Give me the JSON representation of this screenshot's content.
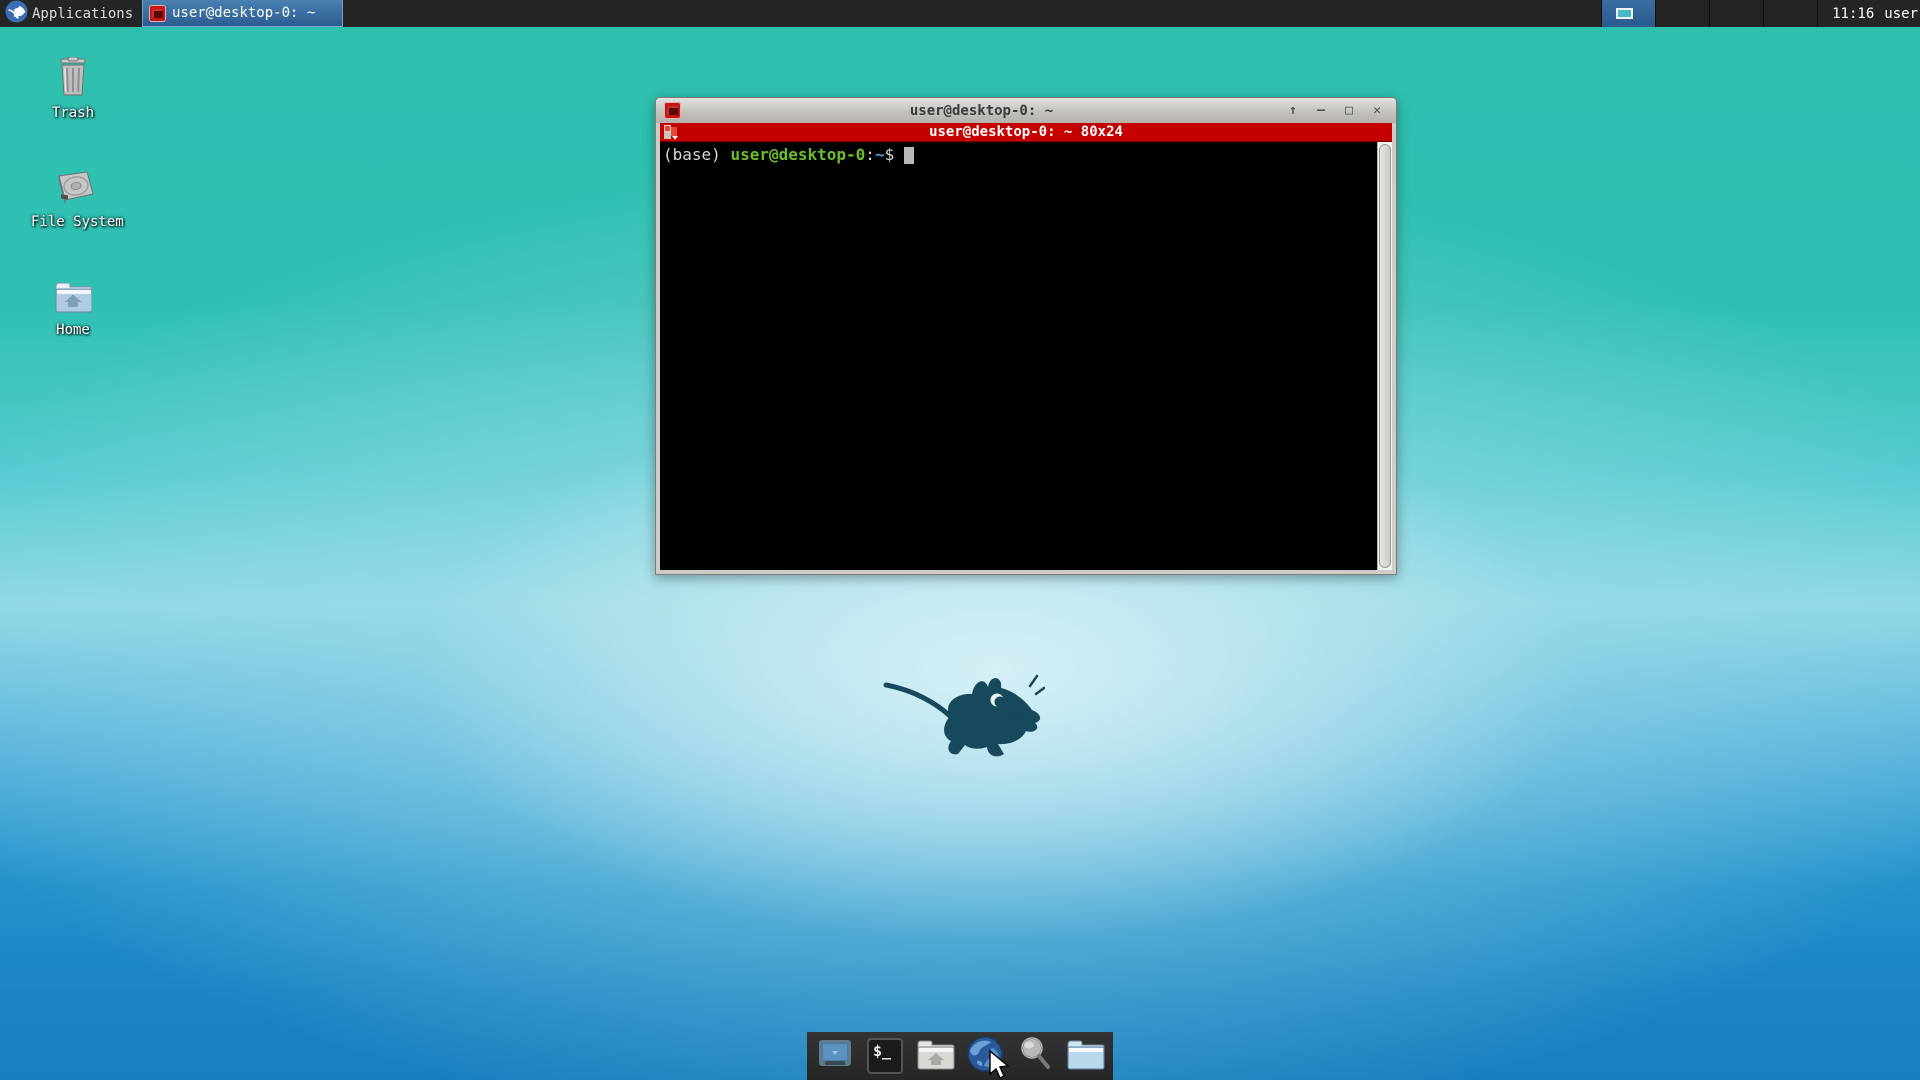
{
  "panel": {
    "applications_label": "Applications",
    "taskbar": {
      "window_title": "user@desktop-0: ~"
    },
    "workspace_count": 4,
    "clock": "11:16",
    "username": "user"
  },
  "desktop": {
    "icons": [
      {
        "label": "Trash"
      },
      {
        "label": "File System"
      },
      {
        "label": "Home"
      }
    ]
  },
  "window": {
    "title": "user@desktop-0: ~",
    "xterm_titlebar": "user@desktop-0: ~ 80x24",
    "terminal": {
      "env_prefix": "(base) ",
      "user_host": "user@desktop-0",
      "colon": ":",
      "cwd": "~",
      "prompt_char": "$ "
    }
  },
  "dock": {
    "items": [
      "show-desktop",
      "terminal",
      "home-folder",
      "web-browser",
      "app-finder",
      "file-manager"
    ]
  },
  "icons": {
    "shade_glyph": "↑",
    "minimize_glyph": "–",
    "maximize_glyph": "□",
    "close_glyph": "✕",
    "dock_terminal_glyph": "$_"
  },
  "colors": {
    "xterm_titlebar_red": "#c40000",
    "prompt_green": "#6cbf2a",
    "prompt_blue": "#4f9fd0",
    "desktop_teal": "#2ebfae",
    "desktop_light": "#9fdbe8",
    "desktop_blue": "#1b84c4",
    "panel_bg": "#252525",
    "taskbar_active_blue": "#3a6ea5"
  }
}
